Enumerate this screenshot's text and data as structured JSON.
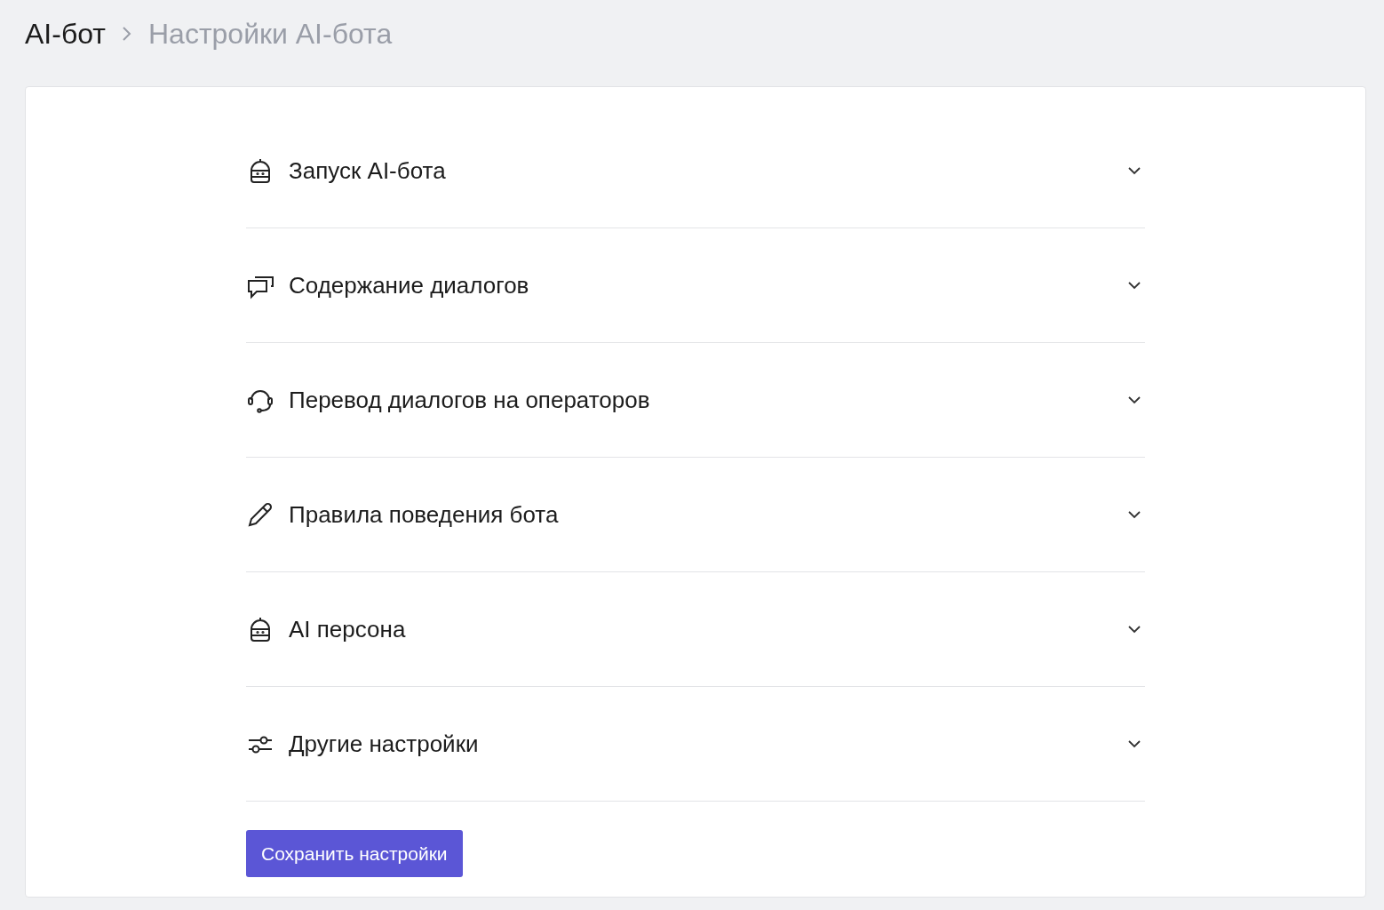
{
  "breadcrumb": [
    {
      "label": "AI-бот",
      "current": false
    },
    {
      "label": "Настройки AI-бота",
      "current": true
    }
  ],
  "sections": [
    {
      "kind": "robot",
      "title": "Запуск AI-бота",
      "expanded": false
    },
    {
      "kind": "chat",
      "title": "Содержание диалогов",
      "expanded": false
    },
    {
      "kind": "headset",
      "title": "Перевод диалогов на операторов",
      "expanded": false
    },
    {
      "kind": "pencil",
      "title": "Правила поведения бота",
      "expanded": false
    },
    {
      "kind": "robot",
      "title": "AI персона",
      "expanded": false
    },
    {
      "kind": "sliders",
      "title": "Другие настройки",
      "expanded": false
    }
  ],
  "save_button": "Сохранить настройки"
}
